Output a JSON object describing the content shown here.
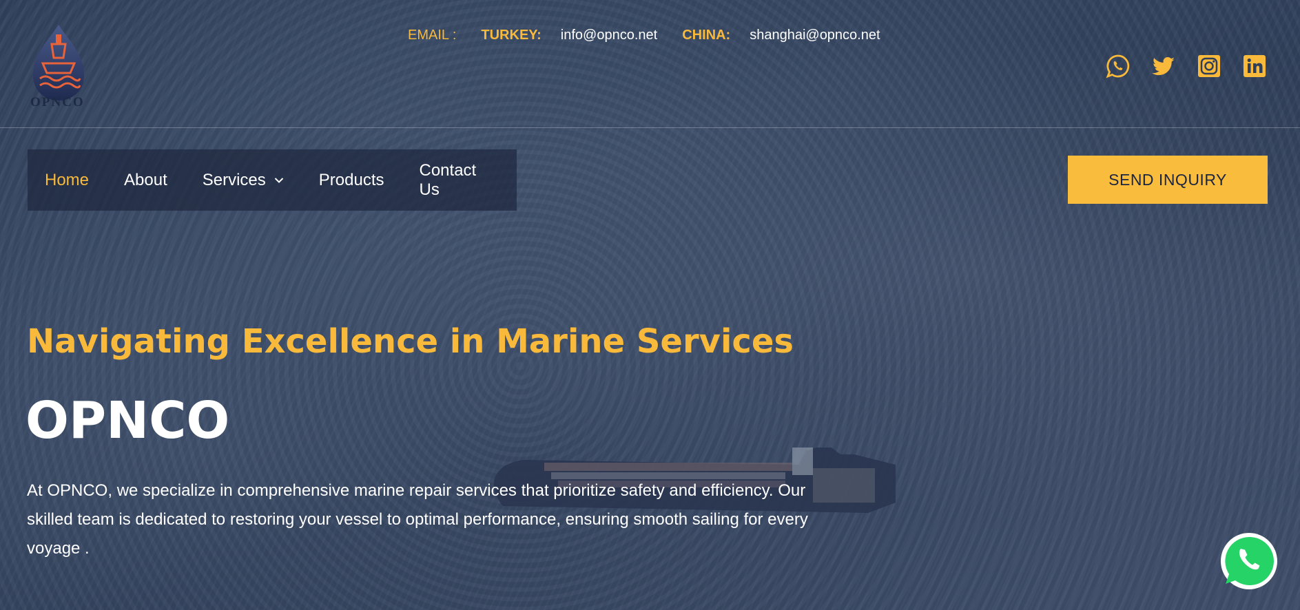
{
  "brand": {
    "logo_text": "OPNCO"
  },
  "contact": {
    "email_label": "EMAIL :",
    "entries": [
      {
        "country": "TURKEY:",
        "email": "info@opnco.net"
      },
      {
        "country": "CHINA:",
        "email": "shanghai@opnco.net"
      }
    ]
  },
  "social": {
    "icons": [
      "whatsapp-icon",
      "twitter-icon",
      "instagram-icon",
      "linkedin-icon"
    ],
    "color": "#f9b93b"
  },
  "nav": {
    "items": [
      {
        "label": "Home",
        "active": true
      },
      {
        "label": "About"
      },
      {
        "label": "Services",
        "has_dropdown": true
      },
      {
        "label": "Products"
      },
      {
        "label": "Contact Us"
      }
    ],
    "cta_label": "SEND INQUIRY"
  },
  "hero": {
    "tagline": "Navigating Excellence in Marine Services",
    "title": "OPNCO",
    "description": "At OPNCO, we specialize in comprehensive marine repair services that prioritize safety and efficiency. Our skilled team is dedicated to restoring your vessel to optimal performance, ensuring smooth sailing for every voyage ."
  },
  "colors": {
    "accent": "#f9b93b",
    "nav_bg": "#1e283e",
    "text": "#ffffff",
    "whatsapp": "#25d366"
  }
}
